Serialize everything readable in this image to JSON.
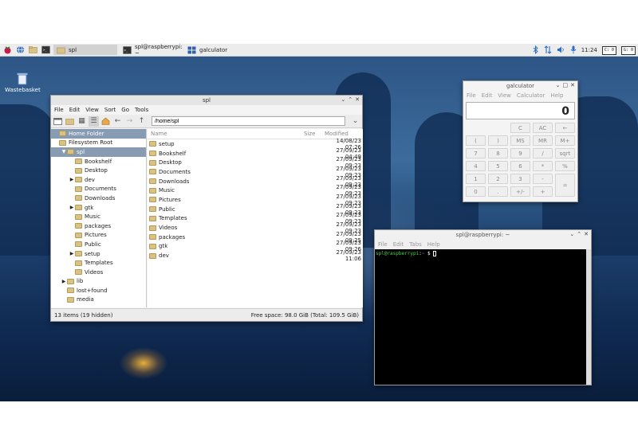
{
  "taskbar": {
    "tasks": [
      {
        "label": "spl"
      },
      {
        "label": "spl@raspberrypi: ~"
      },
      {
        "label": "galculator"
      }
    ],
    "clock": "11:24",
    "cpu_label": "C:",
    "cpu_value": "0",
    "gpu_label": "G:",
    "gpu_value": "0"
  },
  "desktop": {
    "wastebasket_label": "Wastebasket"
  },
  "file_manager": {
    "title": "spl",
    "menu": [
      "File",
      "Edit",
      "View",
      "Sort",
      "Go",
      "Tools"
    ],
    "path": "/home/spl",
    "tree": [
      {
        "label": "Home Folder",
        "indent": 0,
        "selected": true,
        "arrow": ""
      },
      {
        "label": "Filesystem Root",
        "indent": 0,
        "selected": false,
        "arrow": ""
      },
      {
        "label": "spl",
        "indent": 1,
        "selected": true,
        "arrow": "▼"
      },
      {
        "label": "Bookshelf",
        "indent": 2,
        "selected": false,
        "arrow": ""
      },
      {
        "label": "Desktop",
        "indent": 2,
        "selected": false,
        "arrow": ""
      },
      {
        "label": "dev",
        "indent": 2,
        "selected": false,
        "arrow": "▶"
      },
      {
        "label": "Documents",
        "indent": 2,
        "selected": false,
        "arrow": ""
      },
      {
        "label": "Downloads",
        "indent": 2,
        "selected": false,
        "arrow": ""
      },
      {
        "label": "gtk",
        "indent": 2,
        "selected": false,
        "arrow": "▶"
      },
      {
        "label": "Music",
        "indent": 2,
        "selected": false,
        "arrow": ""
      },
      {
        "label": "packages",
        "indent": 2,
        "selected": false,
        "arrow": ""
      },
      {
        "label": "Pictures",
        "indent": 2,
        "selected": false,
        "arrow": ""
      },
      {
        "label": "Public",
        "indent": 2,
        "selected": false,
        "arrow": ""
      },
      {
        "label": "setup",
        "indent": 2,
        "selected": false,
        "arrow": "▶"
      },
      {
        "label": "Templates",
        "indent": 2,
        "selected": false,
        "arrow": ""
      },
      {
        "label": "Videos",
        "indent": 2,
        "selected": false,
        "arrow": ""
      },
      {
        "label": "lib",
        "indent": 1,
        "selected": false,
        "arrow": "▶"
      },
      {
        "label": "lost+found",
        "indent": 1,
        "selected": false,
        "arrow": ""
      },
      {
        "label": "media",
        "indent": 1,
        "selected": false,
        "arrow": ""
      }
    ],
    "columns": {
      "name": "Name",
      "size": "Size",
      "modified": "Modified"
    },
    "files": [
      {
        "name": "setup",
        "modified": "14/08/23 07:26"
      },
      {
        "name": "Bookshelf",
        "modified": "27/09/23 04:49"
      },
      {
        "name": "Desktop",
        "modified": "27/09/23 09:23"
      },
      {
        "name": "Documents",
        "modified": "27/09/23 09:23"
      },
      {
        "name": "Downloads",
        "modified": "27/09/23 09:23"
      },
      {
        "name": "Music",
        "modified": "27/09/23 09:23"
      },
      {
        "name": "Pictures",
        "modified": "27/09/23 09:23"
      },
      {
        "name": "Public",
        "modified": "27/09/23 09:23"
      },
      {
        "name": "Templates",
        "modified": "27/09/23 09:23"
      },
      {
        "name": "Videos",
        "modified": "27/09/23 09:23"
      },
      {
        "name": "packages",
        "modified": "27/09/23 09:25"
      },
      {
        "name": "gtk",
        "modified": "27/09/23 09:26"
      },
      {
        "name": "dev",
        "modified": "27/09/23 11:06"
      }
    ],
    "status_left": "13 items (19 hidden)",
    "status_right": "Free space: 98.0 GiB (Total: 109.5 GiB)"
  },
  "calculator": {
    "title": "galculator",
    "menu": [
      "File",
      "Edit",
      "View",
      "Calculator",
      "Help"
    ],
    "display": "0",
    "keys": [
      {
        "label": "C",
        "col": 3,
        "row": 0
      },
      {
        "label": "AC",
        "col": 4,
        "row": 0
      },
      {
        "label": "←",
        "col": 5,
        "row": 0
      },
      {
        "label": "(",
        "col": 0,
        "row": 1
      },
      {
        "label": ")",
        "col": 1,
        "row": 1
      },
      {
        "label": "MS",
        "col": 2,
        "row": 1
      },
      {
        "label": "MR",
        "col": 3,
        "row": 1
      },
      {
        "label": "M+",
        "col": 4,
        "row": 1
      },
      {
        "label": "7",
        "col": 0,
        "row": 2
      },
      {
        "label": "8",
        "col": 1,
        "row": 2
      },
      {
        "label": "9",
        "col": 2,
        "row": 2
      },
      {
        "label": "/",
        "col": 3,
        "row": 2
      },
      {
        "label": "sqrt",
        "col": 4,
        "row": 2
      },
      {
        "label": "4",
        "col": 0,
        "row": 3
      },
      {
        "label": "5",
        "col": 1,
        "row": 3
      },
      {
        "label": "6",
        "col": 2,
        "row": 3
      },
      {
        "label": "*",
        "col": 3,
        "row": 3
      },
      {
        "label": "%",
        "col": 4,
        "row": 3
      },
      {
        "label": "1",
        "col": 0,
        "row": 4
      },
      {
        "label": "2",
        "col": 1,
        "row": 4
      },
      {
        "label": "3",
        "col": 2,
        "row": 4
      },
      {
        "label": "-",
        "col": 3,
        "row": 4
      },
      {
        "label": "=",
        "col": 4,
        "row": 4
      },
      {
        "label": "0",
        "col": 0,
        "row": 5
      },
      {
        "label": ".",
        "col": 1,
        "row": 5
      },
      {
        "label": "+/-",
        "col": 2,
        "row": 5
      },
      {
        "label": "+",
        "col": 3,
        "row": 5
      }
    ]
  },
  "terminal": {
    "title": "spl@raspberrypi: ~",
    "menu": [
      "File",
      "Edit",
      "Tabs",
      "Help"
    ],
    "prompt_user": "spl@raspberrypi",
    "prompt_sep": ":",
    "prompt_path": "~",
    "prompt_symbol": " $ "
  },
  "colors": {
    "selection": "#879bb2",
    "prompt_user": "#47d447",
    "prompt_path": "#5a7ddc"
  }
}
